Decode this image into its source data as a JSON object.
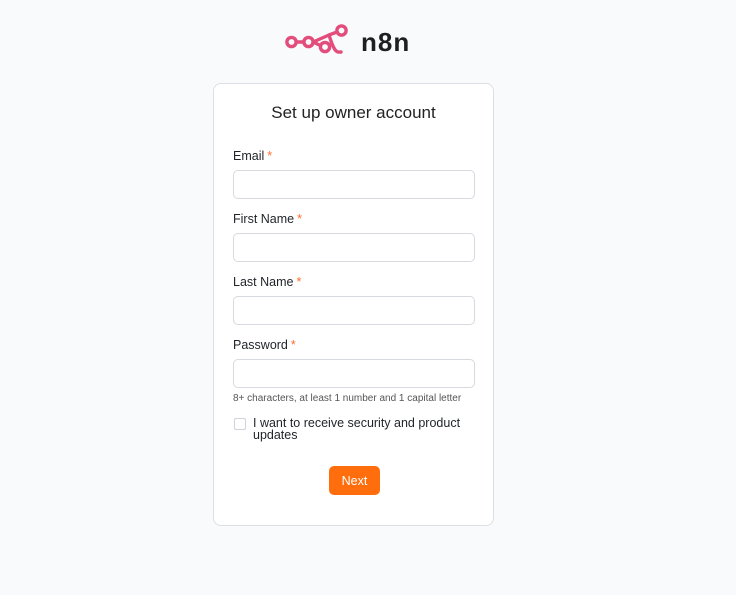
{
  "brand": {
    "name": "n8n",
    "logo_icon": "n8n-nodes-icon",
    "logo_color": "#e24d7b"
  },
  "form": {
    "title": "Set up owner account",
    "required_marker": "*",
    "fields": [
      {
        "label": "Email",
        "value": "",
        "placeholder": ""
      },
      {
        "label": "First Name",
        "value": "",
        "placeholder": ""
      },
      {
        "label": "Last Name",
        "value": "",
        "placeholder": ""
      },
      {
        "label": "Password",
        "value": "",
        "placeholder": ""
      }
    ],
    "password_hint": "8+ characters, at least 1 number and 1 capital letter",
    "checkbox_label": "I want to receive security and product updates",
    "checkbox_checked": false,
    "submit_label": "Next",
    "accent_color": "#ff6d0d"
  }
}
